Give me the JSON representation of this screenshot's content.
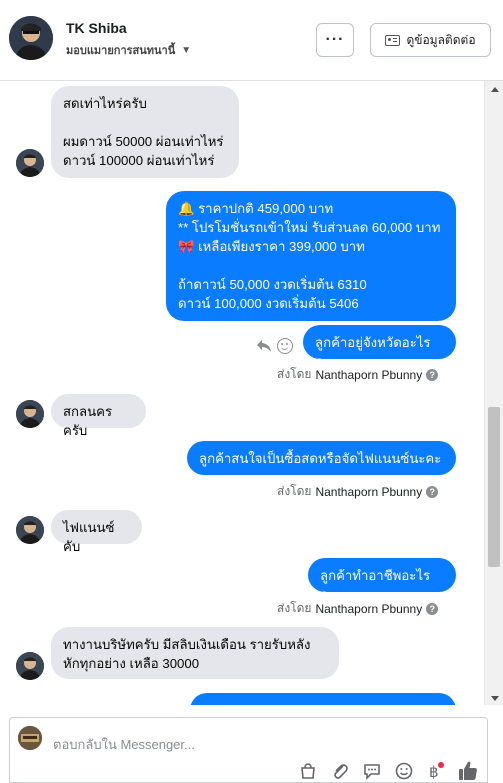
{
  "header": {
    "name": "TK Shiba",
    "subtitle": "มอบแมายการสนทนานี้",
    "more_label": "···",
    "info_label": "ดูข้อมูลติดต่อ"
  },
  "messages": [
    {
      "dir": "in",
      "text": "สดเท่าไหร่ครับ\n\nผมดาวน์ 50000 ผ่อนเท่าไหร่\nดาวน์ 100000 ผ่อนเท่าไหร่"
    },
    {
      "dir": "out",
      "text": "🔔  ราคาปกติ 459,000 บาท\n** โปรโมชั่นรถเข้าใหม่ รับส่วนลด 60,000 บาท\n🎀  เหลือเพียงราคา 399,000 บาท\n\nถ้าดาวน์ 50,000 งวดเริ่มต้น 6310\nดาวน์ 100,000 งวดเริ่มต้น 5406"
    },
    {
      "dir": "out",
      "text": "ลูกค้าอยู่จังหวัดอะไรคะ"
    },
    {
      "dir": "in",
      "text": "สกลนครครับ"
    },
    {
      "dir": "out",
      "text": "ลูกค้าสนใจเป็นซื้อสดหรือจัดไฟแนนซ์นะคะ"
    },
    {
      "dir": "in",
      "text": "ไฟแนนซ์คับ"
    },
    {
      "dir": "out",
      "text": "ลูกค้าทำอาชีพอะไรคะ"
    },
    {
      "dir": "in",
      "text": "ทางานบริษัทครับ มีสลิบเงินเดือน รายรับหลัง\nหักทุกอย่าง เหลือ 30000"
    }
  ],
  "sent_by": {
    "prefix": "ส่งโดย",
    "name": "Nanthaporn Pbunny",
    "help": "?"
  },
  "composer": {
    "placeholder": "ตอบกลับใน Messenger..."
  },
  "colors": {
    "outgoing": "#0a7cff",
    "incoming": "#e4e6eb",
    "like": "#0a7cff",
    "dot": "#f02849"
  },
  "icons": [
    "reply-icon",
    "emoji-icon",
    "bag-icon",
    "attach-icon",
    "chat-bubble-icon",
    "smile-icon",
    "baht-icon",
    "like-icon"
  ]
}
